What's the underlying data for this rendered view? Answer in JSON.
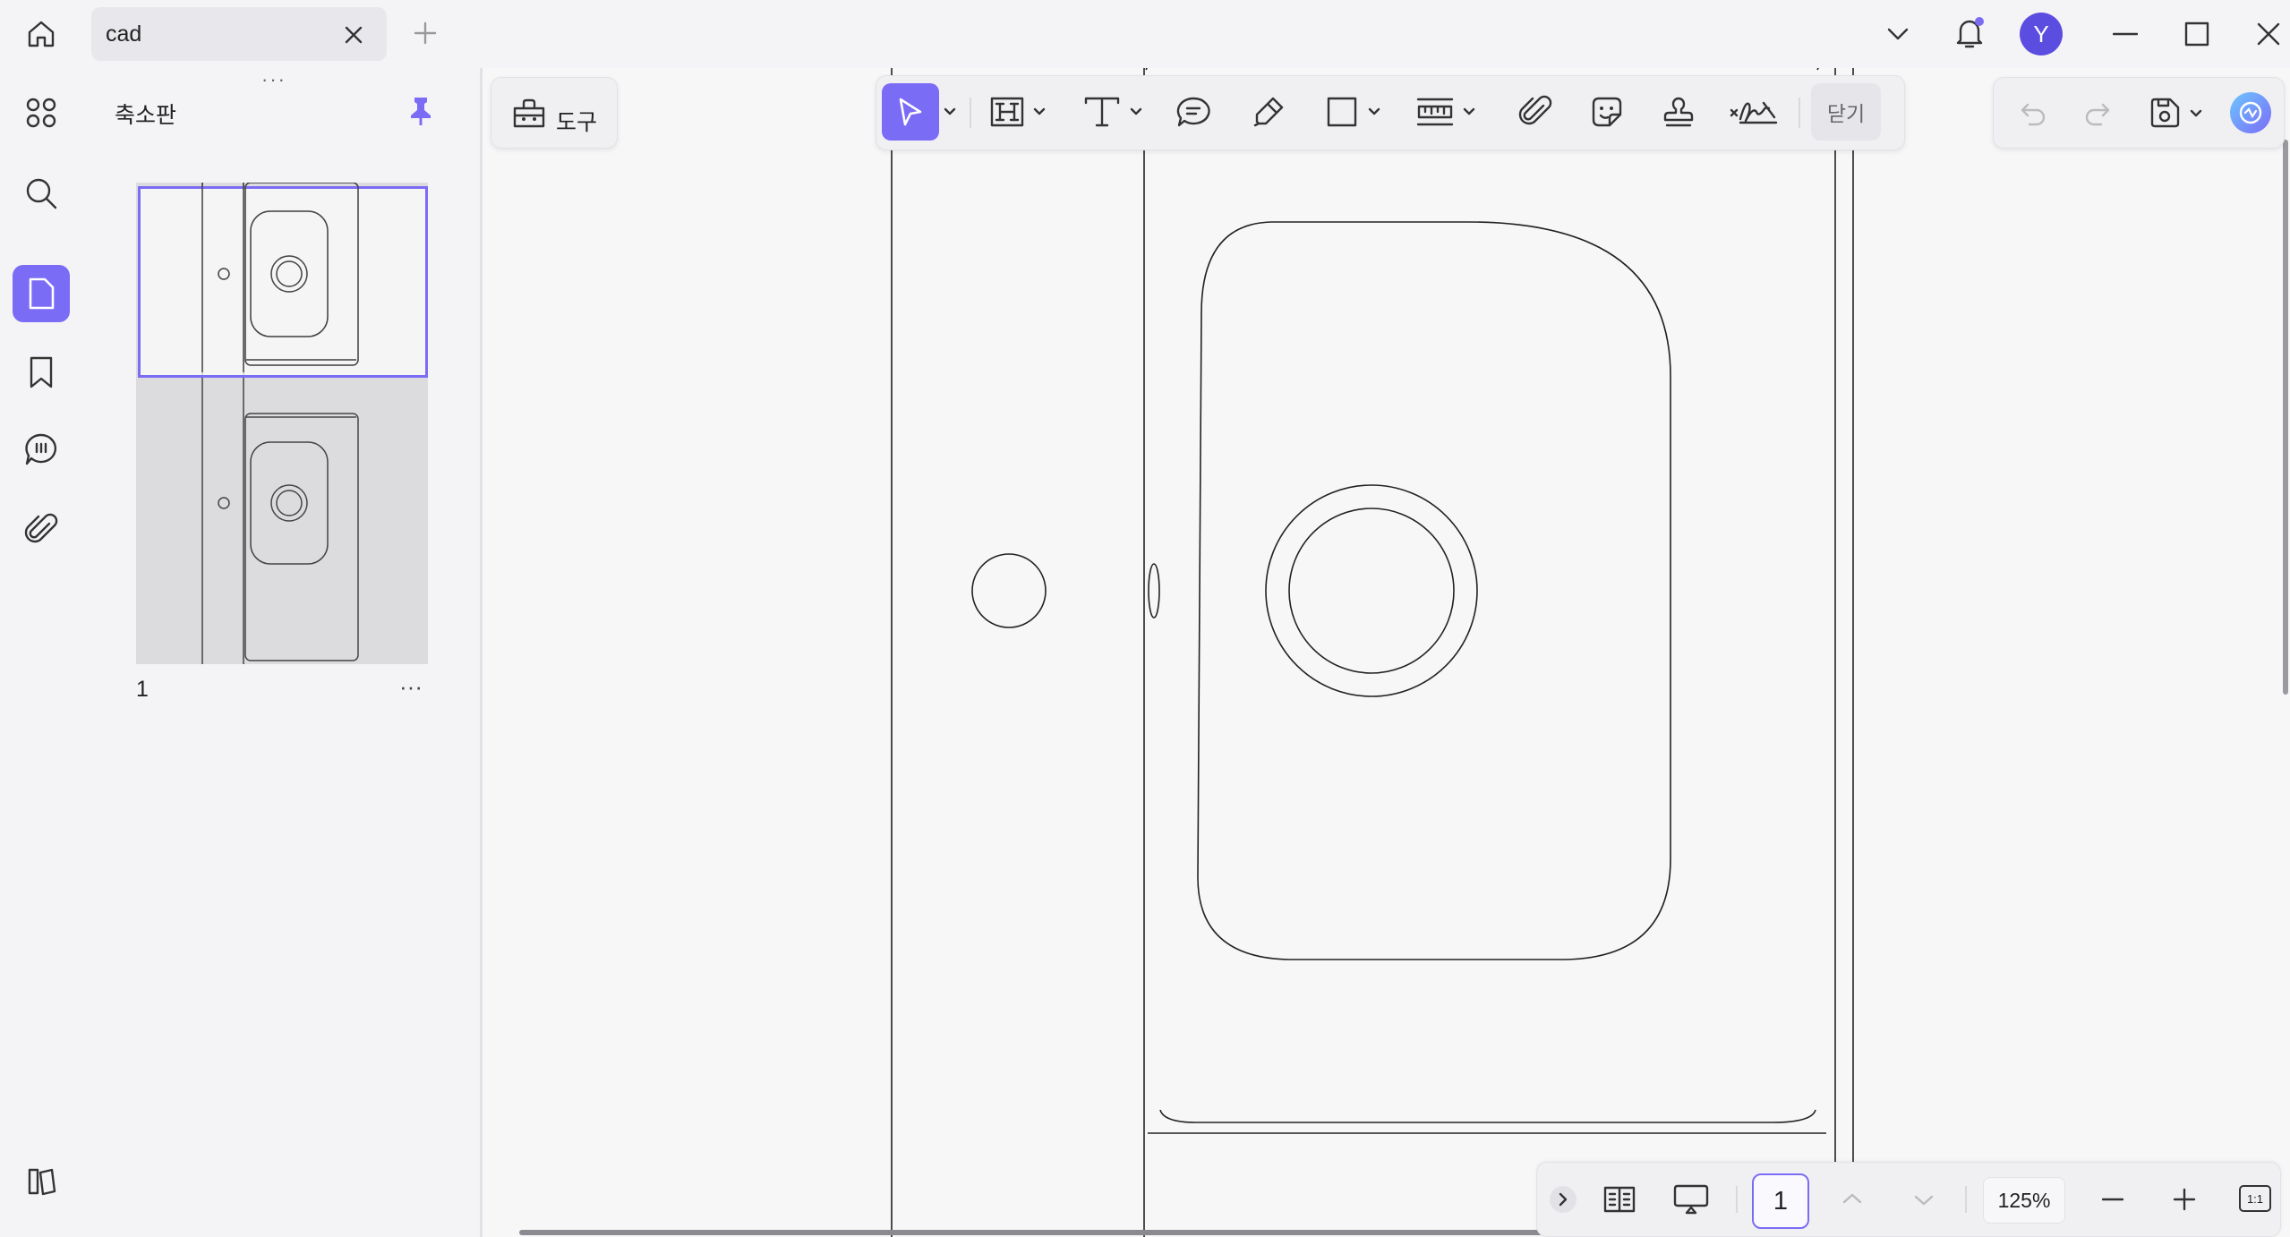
{
  "window": {
    "tab_title": "cad",
    "avatar_letter": "Y",
    "accent": "#7b6cf6",
    "avatar_color": "#5b4de0"
  },
  "thumbnails": {
    "title": "축소판",
    "page_label": "1",
    "more": "···",
    "grip": "···"
  },
  "toolbar": {
    "tools_label": "도구",
    "close_label": "닫기",
    "items": [
      "select-icon",
      "heading-icon",
      "text-icon",
      "comment-icon",
      "highlighter-icon",
      "rectangle-icon",
      "measure-icon",
      "attachment-icon",
      "sticker-icon",
      "stamp-icon",
      "signature-icon"
    ]
  },
  "bottom": {
    "page_number": "1",
    "zoom": "125%",
    "fit_label": "1:1"
  },
  "rail": {
    "items": [
      "apps-icon",
      "search-icon",
      "page-thumbnails-icon",
      "bookmark-icon",
      "comments-icon",
      "attachment-icon",
      "library-icon"
    ]
  }
}
